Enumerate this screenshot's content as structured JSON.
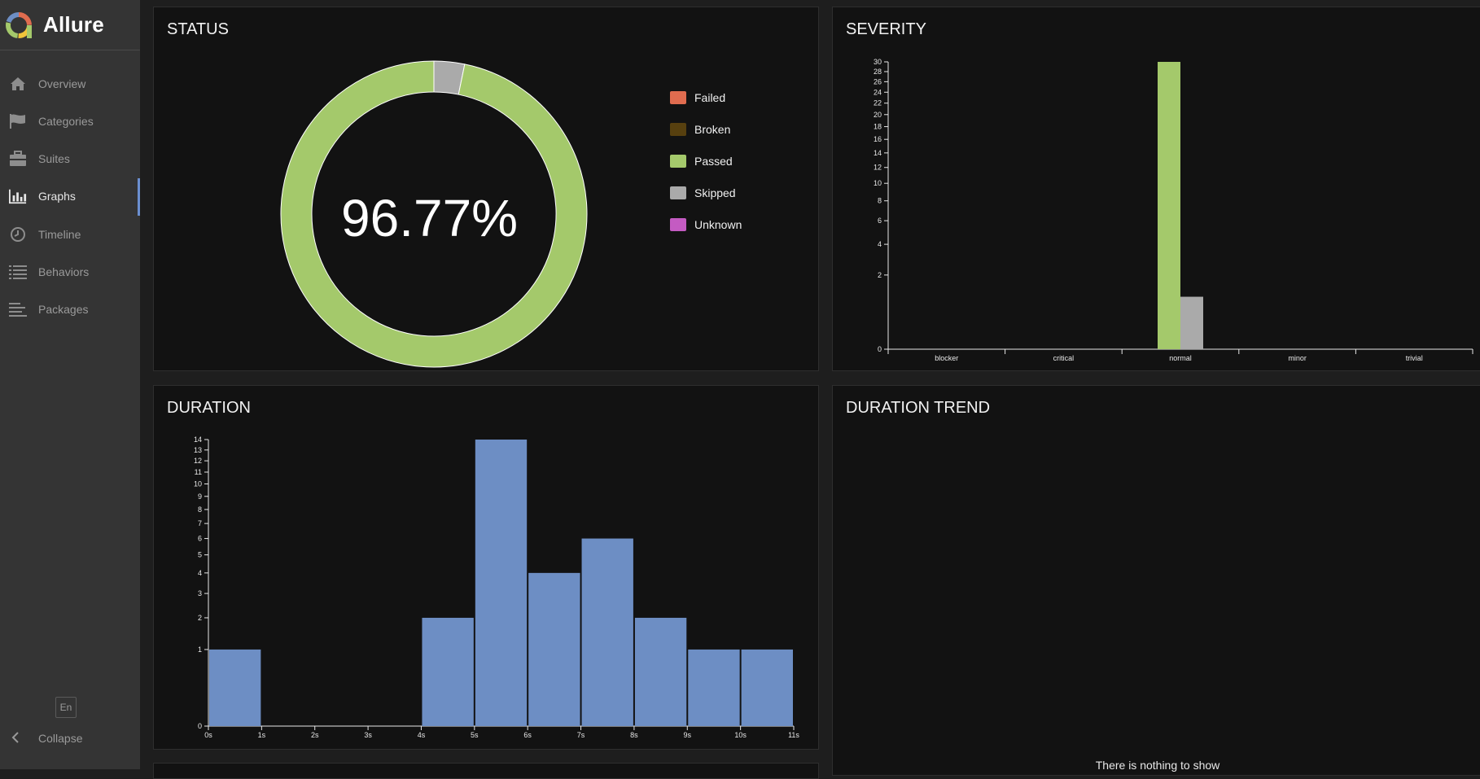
{
  "app": {
    "name": "Allure"
  },
  "nav": {
    "items": [
      {
        "label": "Overview",
        "icon": "home-icon"
      },
      {
        "label": "Categories",
        "icon": "flag-icon"
      },
      {
        "label": "Suites",
        "icon": "briefcase-icon"
      },
      {
        "label": "Graphs",
        "icon": "bar-chart-icon",
        "active": true
      },
      {
        "label": "Timeline",
        "icon": "clock-icon"
      },
      {
        "label": "Behaviors",
        "icon": "list-icon"
      },
      {
        "label": "Packages",
        "icon": "align-left-icon"
      }
    ],
    "language": "En",
    "collapse": "Collapse"
  },
  "widgets": {
    "status": {
      "title": "STATUS",
      "percent": "96.77%",
      "legend": [
        {
          "label": "Failed",
          "color": "#e06c4f"
        },
        {
          "label": "Broken",
          "color": "#57400f"
        },
        {
          "label": "Passed",
          "color": "#a4c96b"
        },
        {
          "label": "Skipped",
          "color": "#aaaaaa"
        },
        {
          "label": "Unknown",
          "color": "#c45bc2"
        }
      ]
    },
    "severity": {
      "title": "SEVERITY"
    },
    "duration": {
      "title": "DURATION"
    },
    "duration_trend": {
      "title": "DURATION TREND",
      "empty_message": "There is nothing to show"
    }
  },
  "chart_data": [
    {
      "type": "pie",
      "title": "STATUS",
      "labels": [
        "Passed",
        "Skipped"
      ],
      "values": [
        30,
        1
      ],
      "colors": [
        "#a4c96b",
        "#aaaaaa"
      ],
      "center_label": "96.77%"
    },
    {
      "type": "bar",
      "title": "SEVERITY",
      "categories": [
        "blocker",
        "critical",
        "normal",
        "minor",
        "trivial"
      ],
      "series": [
        {
          "name": "Passed",
          "values": [
            0,
            0,
            30,
            0,
            0
          ],
          "color": "#a4c96b"
        },
        {
          "name": "Skipped",
          "values": [
            0,
            0,
            1,
            0,
            0
          ],
          "color": "#aaaaaa"
        }
      ],
      "y_scale": "sqrt",
      "y_ticks": [
        0,
        2,
        4,
        6,
        8,
        10,
        12,
        14,
        16,
        18,
        20,
        22,
        24,
        26,
        28,
        30
      ],
      "ylim": [
        0,
        30
      ]
    },
    {
      "type": "bar",
      "title": "DURATION",
      "x_ticks": [
        "0s",
        "1s",
        "2s",
        "3s",
        "4s",
        "5s",
        "6s",
        "7s",
        "8s",
        "9s",
        "10s",
        "11s"
      ],
      "bins": [
        {
          "from": 0,
          "to": 1,
          "count": 1
        },
        {
          "from": 4,
          "to": 5,
          "count": 2
        },
        {
          "from": 5,
          "to": 6,
          "count": 14
        },
        {
          "from": 6,
          "to": 7,
          "count": 4
        },
        {
          "from": 7,
          "to": 8,
          "count": 6
        },
        {
          "from": 8,
          "to": 9,
          "count": 2
        },
        {
          "from": 9,
          "to": 10,
          "count": 1
        },
        {
          "from": 10,
          "to": 11,
          "count": 1
        }
      ],
      "color": "#6d8ec4",
      "y_scale": "sqrt",
      "y_ticks": [
        0,
        1,
        2,
        3,
        4,
        5,
        6,
        7,
        8,
        9,
        10,
        11,
        12,
        13,
        14
      ],
      "ylim": [
        0,
        14
      ]
    }
  ]
}
